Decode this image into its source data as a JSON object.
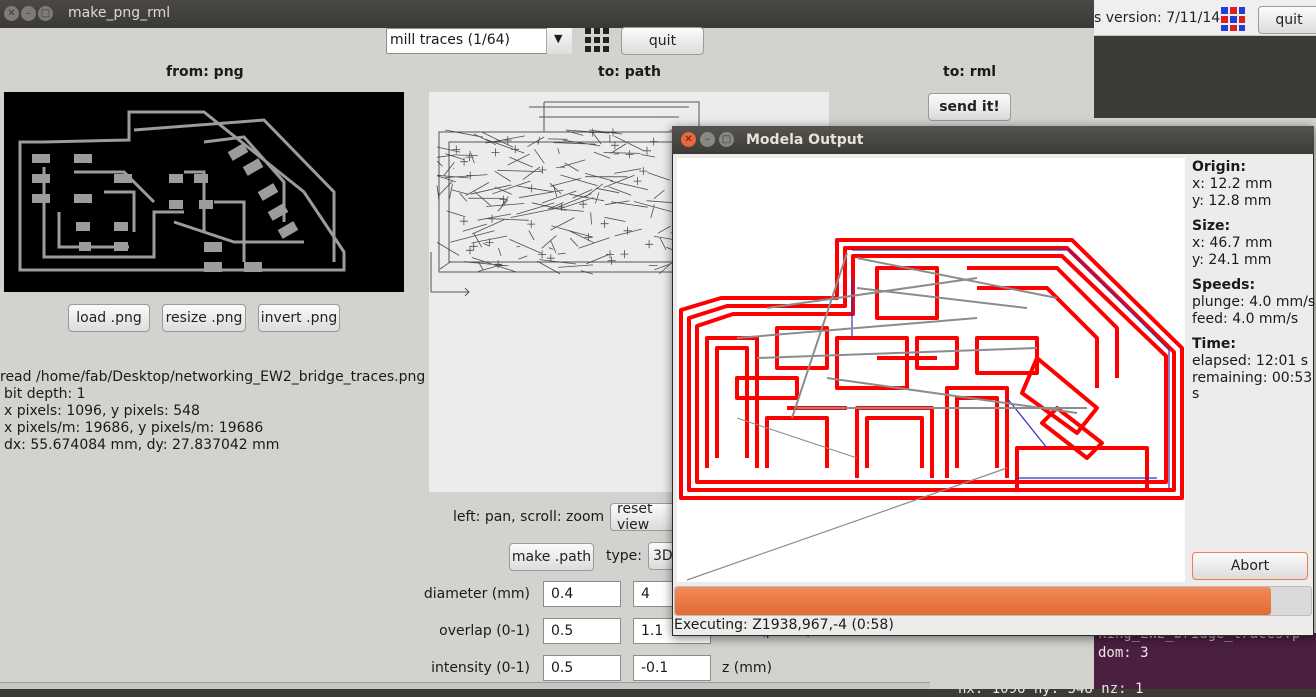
{
  "background_app": {
    "version_text": "s version: 7/11/14",
    "quit_label": "quit",
    "terminal_line1": "king_EW2_bridge_traces.p",
    "terminal_line2": "dom: 3",
    "terminal_line3": "nx: 1096  ny: 548  nz: 1"
  },
  "main_window": {
    "title": "make_png_rml",
    "mode_select": {
      "value": "mill traces (1/64)"
    },
    "quit_label": "quit",
    "from_label": "from: png",
    "to_path_label": "to: path",
    "to_rml_label": "to: rml",
    "send_label": "send it!",
    "buttons": {
      "load": "load .png",
      "resize": "resize .png",
      "invert": "invert .png"
    },
    "info_lines": [
      "read /home/fab/Desktop/networking_EW2_bridge_traces.png",
      "bit depth: 1",
      "x pixels: 1096, y pixels: 548",
      "x pixels/m: 19686, y pixels/m: 19686",
      "dx: 55.674084 mm, dy: 27.837042 mm"
    ],
    "pan_label": "left: pan, scroll: zoom",
    "reset_label": "reset view",
    "make_path_label": "make .path",
    "type_label": "type:",
    "type_value": "3D",
    "params": {
      "diameter_label": "diameter (mm)",
      "diameter": "0.4",
      "diameter2": "4",
      "overlap_label": "overlap (0-1)",
      "overlap": "0.5",
      "overlap2": "1.1",
      "overlap2_label": "error (pixels)",
      "intensity_label": "intensity (0-1)",
      "intensity": "0.5",
      "intensity2": "-0.1",
      "z_label": "z (mm)"
    }
  },
  "modela_window": {
    "title": "Modela Output",
    "origin_label": "Origin:",
    "origin_x": "x: 12.2 mm",
    "origin_y": "y: 12.8 mm",
    "size_label": "Size:",
    "size_x": "x: 46.7 mm",
    "size_y": "y: 24.1 mm",
    "speeds_label": "Speeds:",
    "plunge": "plunge: 4.0 mm/s",
    "feed": "feed: 4.0 mm/s",
    "time_label": "Time:",
    "elapsed": "elapsed: 12:01 s",
    "remaining": "remaining: 00:53 s",
    "abort_label": "Abort",
    "progress": 0.937,
    "executing": "Executing: Z1938,967,-4 (0:58)"
  },
  "colors": {
    "toolpath_red": "#ff0000",
    "toolpath_blue": "#3030c0",
    "travel_gray": "#8c8c8c",
    "progress_orange": "#e8703a"
  }
}
